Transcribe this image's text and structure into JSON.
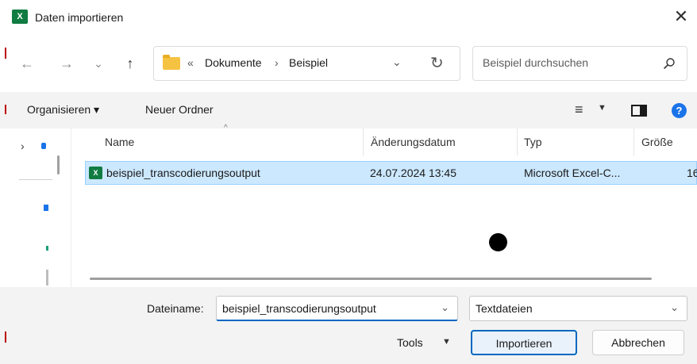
{
  "window": {
    "title": "Daten importieren",
    "app_icon_label": "X",
    "close_glyph": "✕"
  },
  "nav": {
    "back_glyph": "←",
    "forward_glyph": "→",
    "recent_glyph": "⌄",
    "up_glyph": "↑",
    "breadcrumb_prefix": "«",
    "breadcrumb": [
      "Dokumente",
      "Beispiel"
    ],
    "breadcrumb_sep": "›",
    "address_dropdown_glyph": "⌄",
    "refresh_glyph": "↻",
    "search_placeholder": "Beispiel durchsuchen"
  },
  "toolbar": {
    "organize_label": "Organisieren ▾",
    "new_folder_label": "Neuer Ordner",
    "view_glyph": "≡",
    "view_chevron": "▼",
    "help_glyph": "?"
  },
  "leftpane": {
    "chevron_glyph": "›"
  },
  "columns": {
    "sort_glyph": "^",
    "name": "Name",
    "date": "Änderungsdatum",
    "type": "Typ",
    "size": "Größe"
  },
  "files": [
    {
      "icon_label": "X",
      "name": "beispiel_transcodierungsoutput",
      "date": "24.07.2024 13:45",
      "type": "Microsoft Excel-C...",
      "size": "16"
    }
  ],
  "footer": {
    "filename_label": "Dateiname:",
    "filename_value": "beispiel_transcodierungsoutput",
    "filename_chevron": "⌄",
    "filetype_value": "Textdateien",
    "filetype_chevron": "⌄",
    "tools_label": "Tools",
    "tools_chevron": "▼",
    "import_label": "Importieren",
    "cancel_label": "Abbrechen"
  },
  "colors": {
    "accent": "#0067c0",
    "selection_bg": "#cce8ff",
    "excel_green": "#107c41",
    "folder_yellow": "#f5c242"
  }
}
